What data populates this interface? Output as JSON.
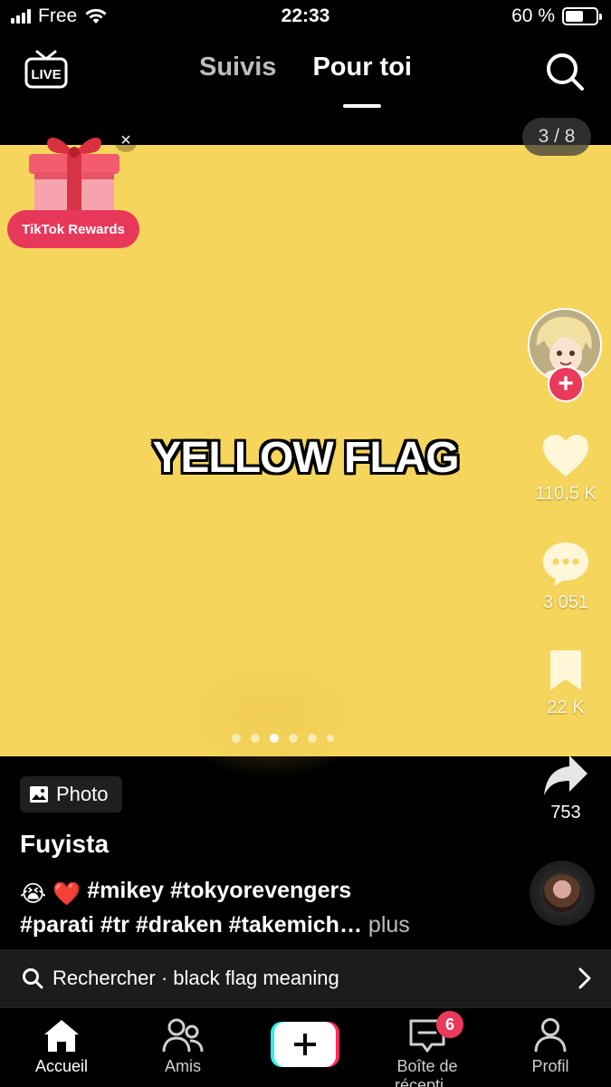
{
  "status_bar": {
    "carrier": "Free",
    "time": "22:33",
    "battery": "60 %",
    "battery_level": 0.6
  },
  "top_nav": {
    "live_label": "LIVE",
    "tabs": [
      {
        "label": "Suivis",
        "active": false
      },
      {
        "label": "Pour toi",
        "active": true
      }
    ]
  },
  "media": {
    "overlay_text": "YELLOW FLAG",
    "page_counter": "3 / 8",
    "background_color": "#f6d55c",
    "dots_count": 6,
    "active_dot": 2
  },
  "rewards": {
    "label": "TikTok Rewards",
    "close_symbol": "×"
  },
  "rail": {
    "likes": "110,5 K",
    "comments": "3 051",
    "bookmarks": "22 K",
    "shares": "753",
    "follow_symbol": "+"
  },
  "post": {
    "badge_label": "Photo",
    "author": "Fuyista",
    "caption_emojis": [
      "😭",
      "❤️"
    ],
    "caption_line1": "#mikey #tokyorevengers",
    "caption_line2": "#parati #tr #draken #takemich…",
    "more_label": "plus"
  },
  "search_suggestion": {
    "label": "Rechercher · black flag meaning"
  },
  "tabbar": {
    "items": [
      {
        "label": "Accueil",
        "icon": "home-icon",
        "active": true
      },
      {
        "label": "Amis",
        "icon": "friends-icon",
        "active": false
      },
      {
        "label": "",
        "icon": "create-icon",
        "active": false
      },
      {
        "label": "Boîte de récepti…",
        "icon": "inbox-icon",
        "active": false
      },
      {
        "label": "Profil",
        "icon": "profile-icon",
        "active": false
      }
    ],
    "inbox_badge": "6"
  },
  "colors": {
    "accent": "#ea3a5b",
    "media_bg": "#f6d55c"
  }
}
